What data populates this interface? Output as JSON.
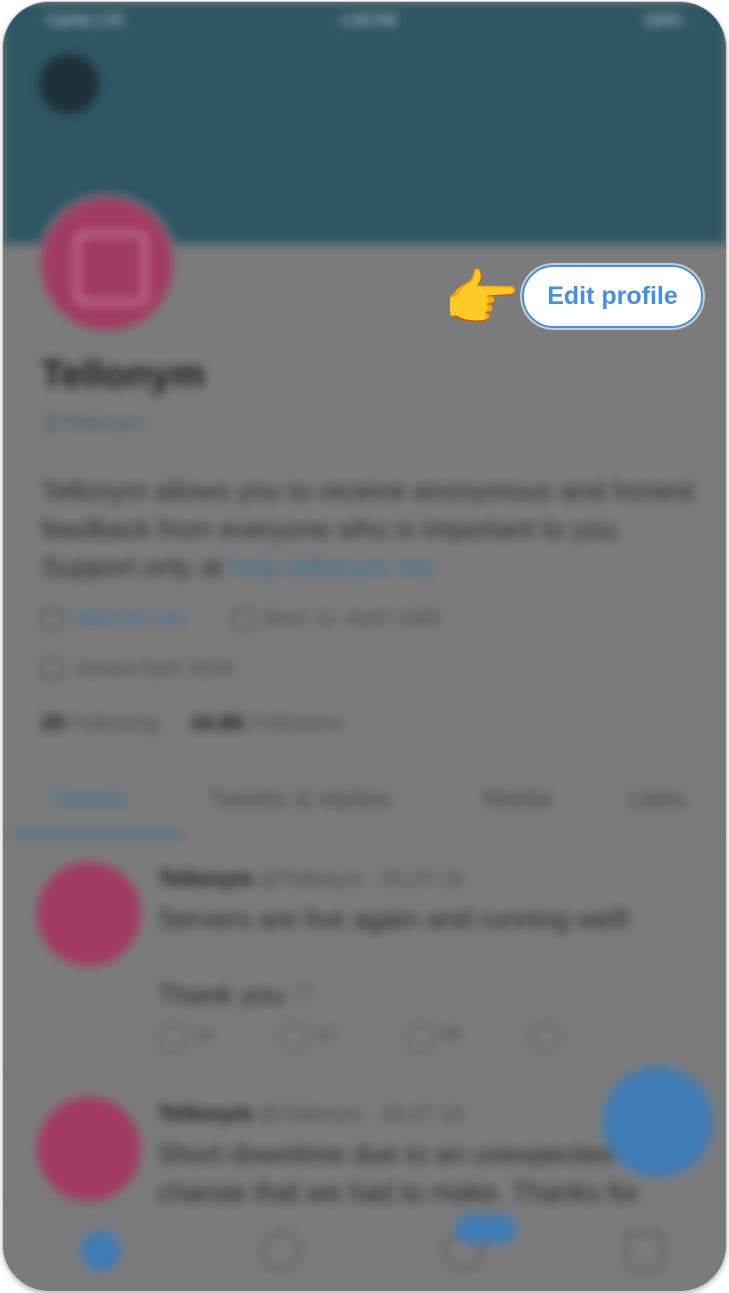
{
  "status_bar": {
    "carrier": "Carrier LTE",
    "time": "1:00 PM",
    "battery": "100%"
  },
  "profile": {
    "name": "Tellonym",
    "handle": "@Tellonym",
    "bio_text": "Tellonym allows you to receive anonymous and honest feedback from everyone who is important to you. Support only at ",
    "bio_link": "help.tellonym.me",
    "website": "tellonym.me",
    "birthday": "Born 11. April 1990",
    "joined": "Joined April 2016",
    "following_count": "29",
    "following_label": "Following",
    "followers_count": "34.8K",
    "followers_label": "Followers"
  },
  "actions": {
    "edit_profile_label": "Edit profile",
    "pointer_emoji": "👉"
  },
  "tabs": [
    "Tweets",
    "Tweets & replies",
    "Media",
    "Likes"
  ],
  "tweets": [
    {
      "name": "Tellonym",
      "handle": "@Tellonym",
      "date": "05.07.19",
      "text": "Servers are live again and running well!\n\nThank you ♡",
      "replies": "14",
      "retweets": "12",
      "likes": "95"
    },
    {
      "name": "Tellonym",
      "handle": "@Tellonym",
      "date": "05.07.19",
      "text": "Short downtime due to an unexpected change that we had to make. Thanks for"
    }
  ],
  "colors": {
    "accent": "#4a90d9",
    "avatar": "#a23b63",
    "banner": "#2f5665"
  }
}
